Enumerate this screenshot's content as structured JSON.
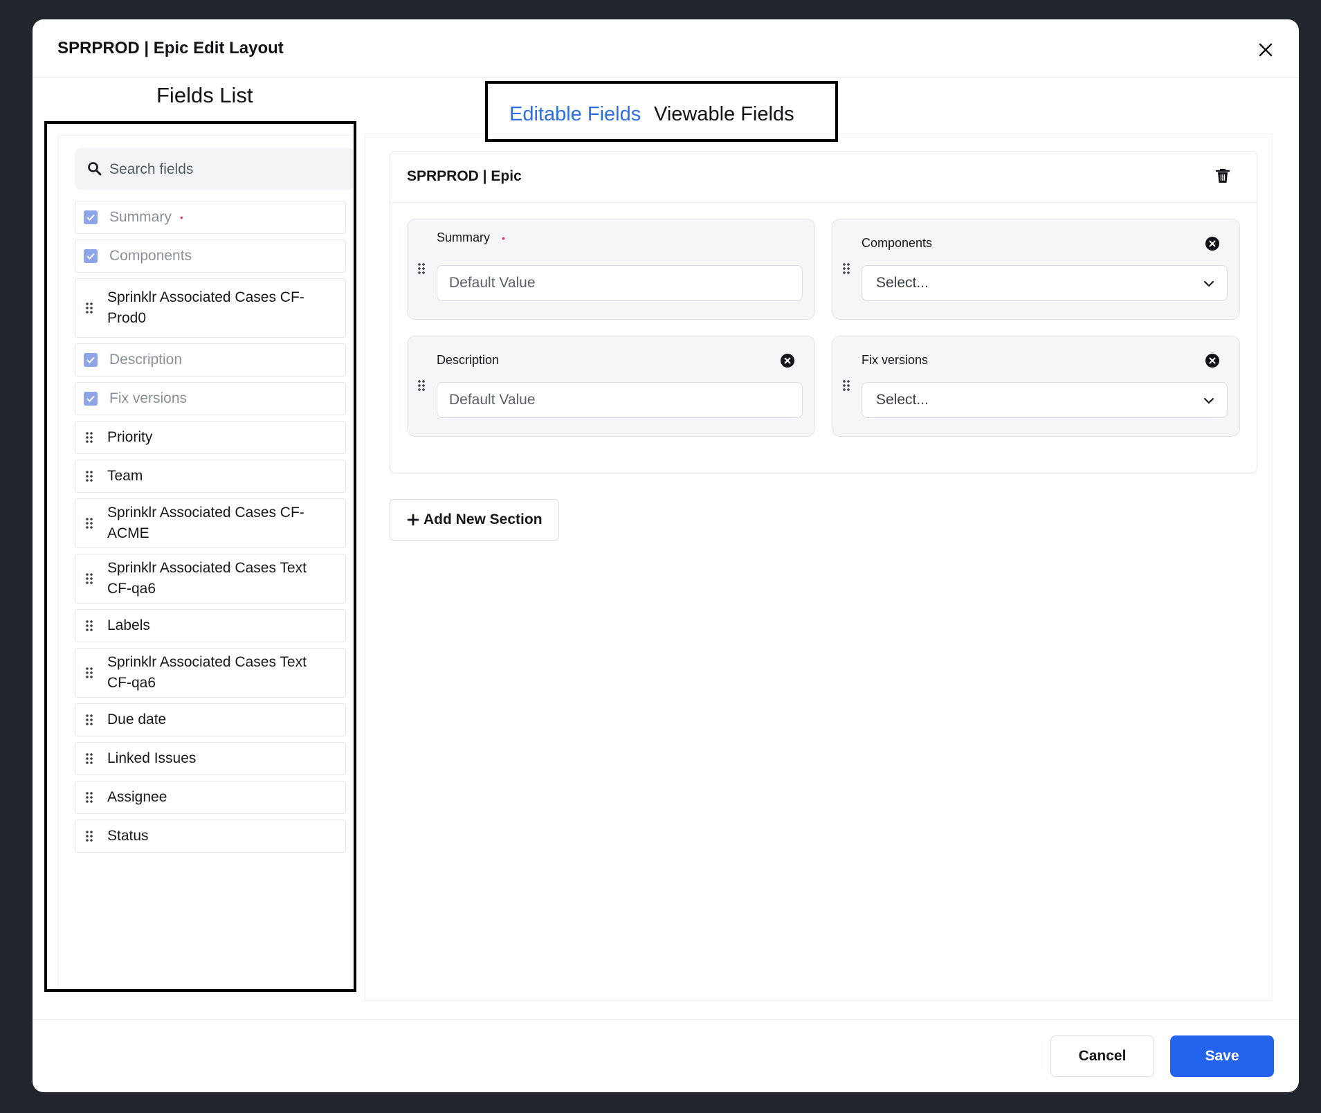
{
  "modal": {
    "title": "SPRPROD | Epic Edit Layout"
  },
  "fields_list": {
    "label": "Fields List",
    "search_placeholder": "Search fields",
    "items": [
      {
        "label": "Summary",
        "checked": true,
        "required": true
      },
      {
        "label": "Components",
        "checked": true
      },
      {
        "label": "Sprinklr Associated Cases CF-Prod0",
        "checked": false
      },
      {
        "label": "Description",
        "checked": true
      },
      {
        "label": "Fix versions",
        "checked": true
      },
      {
        "label": "Priority",
        "checked": false
      },
      {
        "label": "Team",
        "checked": false
      },
      {
        "label": "Sprinklr Associated Cases CF-ACME",
        "checked": false
      },
      {
        "label": "Sprinklr Associated Cases Text CF-qa6",
        "checked": false
      },
      {
        "label": "Labels",
        "checked": false
      },
      {
        "label": "Sprinklr Associated Cases Text CF-qa6",
        "checked": false
      },
      {
        "label": "Due date",
        "checked": false
      },
      {
        "label": "Linked Issues",
        "checked": false
      },
      {
        "label": "Assignee",
        "checked": false
      },
      {
        "label": "Status",
        "checked": false
      }
    ],
    "required_mark": "•"
  },
  "tabs": {
    "editable": "Editable Fields",
    "viewable": "Viewable Fields",
    "active": "editable",
    "active_color": "#2d6fe0"
  },
  "section": {
    "title": "SPRPROD | Epic",
    "fields": [
      {
        "label": "Summary",
        "required": true,
        "control": "input",
        "placeholder": "Default Value"
      },
      {
        "label": "Components",
        "control": "select",
        "value": "Select..."
      },
      {
        "label": "Description",
        "control": "input",
        "placeholder": "Default Value"
      },
      {
        "label": "Fix versions",
        "control": "select",
        "value": "Select..."
      }
    ]
  },
  "add_section_label": "Add New Section",
  "footer": {
    "cancel": "Cancel",
    "save": "Save",
    "save_color": "#2463eb"
  },
  "icons": {
    "close": "close-icon",
    "search": "search-icon",
    "checkbox": "checkbox-checked-icon",
    "drag": "drag-handle-icon",
    "trash": "trash-icon",
    "remove": "remove-circle-icon",
    "chevron": "chevron-down-icon",
    "plus": "plus-icon"
  }
}
